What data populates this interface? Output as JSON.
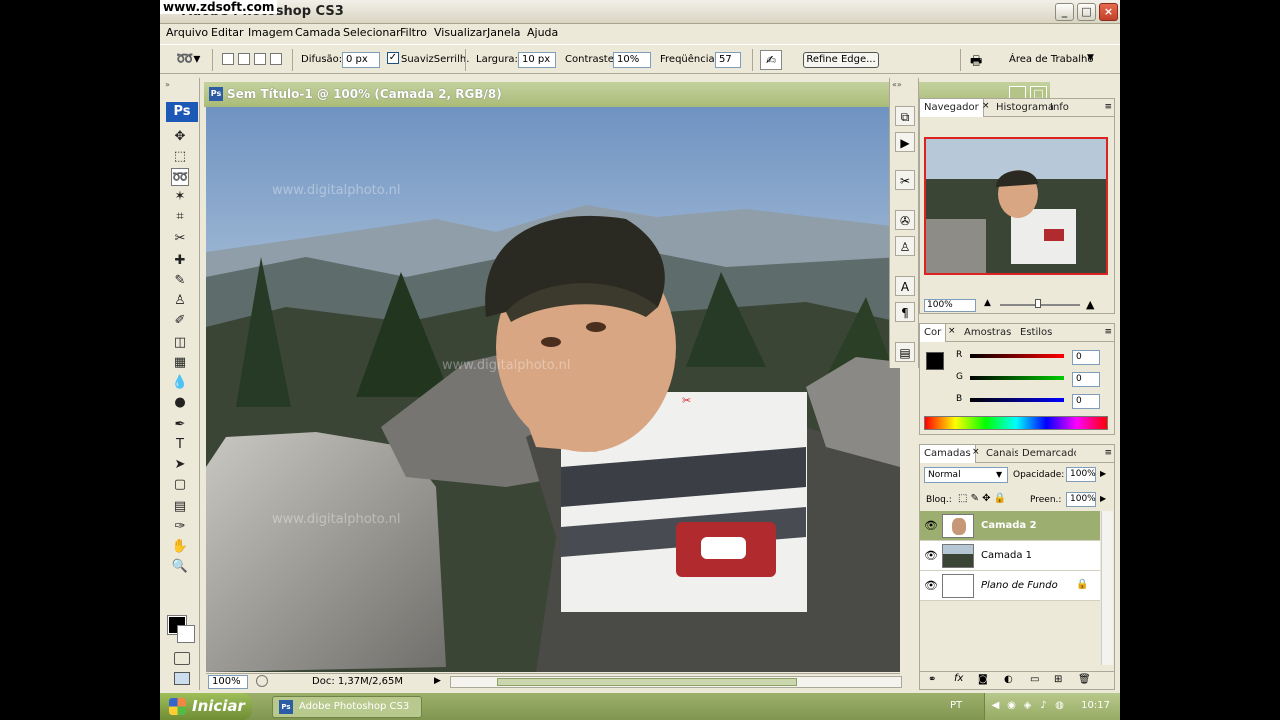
{
  "watermark": "www.zdsoft.com",
  "app": {
    "title": "Adobe Photoshop CS3",
    "window_buttons": {
      "minimize": "_",
      "maximize": "□",
      "close": "×"
    }
  },
  "menu": [
    "Arquivo",
    "Editar",
    "Imagem",
    "Camada",
    "Selecionar",
    "Filtro",
    "Visualizar",
    "Janela",
    "Ajuda"
  ],
  "options": {
    "feather_label": "Difusão:",
    "feather_value": "0 px",
    "antialias_label": "SuavizSerrilh.",
    "width_label": "Largura:",
    "width_value": "10 px",
    "contrast_label": "Contraste:",
    "contrast_value": "10%",
    "frequency_label": "Freqüência:",
    "frequency_value": "57",
    "refine_edge": "Refine Edge...",
    "workspace": "Área de Trabalho"
  },
  "tools": {
    "logo": "Ps",
    "icons": [
      "move-icon",
      "marquee-icon",
      "magnetic-lasso-icon",
      "magic-wand-icon",
      "crop-icon",
      "slice-icon",
      "healing-brush-icon",
      "brush-icon",
      "clone-stamp-icon",
      "history-brush-icon",
      "eraser-icon",
      "gradient-icon",
      "blur-icon",
      "dodge-icon",
      "pen-icon",
      "type-icon",
      "path-selection-icon",
      "shape-icon",
      "notes-icon",
      "eyedropper-icon",
      "hand-icon",
      "zoom-icon"
    ],
    "glyphs": [
      "✥",
      "⬚",
      "➿",
      "✶",
      "⌗",
      "✂",
      "✚",
      "✎",
      "♙",
      "✐",
      "◫",
      "▦",
      "💧",
      "●",
      "✒",
      "T",
      "➤",
      "▢",
      "▤",
      "✑",
      "✋",
      "🔍"
    ],
    "fg_color": "#000000",
    "bg_color": "#ffffff"
  },
  "document": {
    "title": "Sem Título-1 @ 100% (Camada 2, RGB/8)",
    "doc_icon": "Ps",
    "canvas_watermark": "www.digitalphoto.nl",
    "zoom": "100%",
    "info": "Doc: 1,37M/2,65M"
  },
  "navigator": {
    "tabs": [
      "Navegador",
      "Histograma",
      "Info"
    ],
    "zoom": "100%"
  },
  "color": {
    "tabs": [
      "Cor",
      "Amostras",
      "Estilos"
    ],
    "channels": [
      {
        "letter": "R",
        "value": "0",
        "gradient": "linear-gradient(90deg,#000,#f00)"
      },
      {
        "letter": "G",
        "value": "0",
        "gradient": "linear-gradient(90deg,#000,#0c0)"
      },
      {
        "letter": "B",
        "value": "0",
        "gradient": "linear-gradient(90deg,#000,#00f)"
      }
    ]
  },
  "layers": {
    "tabs": [
      "Camadas",
      "Canais",
      "Demarcadores"
    ],
    "blend_mode": "Normal",
    "opacity_label": "Opacidade:",
    "opacity_value": "100%",
    "lock_label": "Bloq.:",
    "fill_label": "Preen.:",
    "fill_value": "100%",
    "items": [
      {
        "name": "Camada 2",
        "selected": true
      },
      {
        "name": "Camada 1",
        "selected": false
      },
      {
        "name": "Plano de Fundo",
        "selected": false,
        "locked": true
      }
    ],
    "bottom_icons": [
      "⚭",
      "fx",
      "◙",
      "◐",
      "▭",
      "⊞",
      "🗑"
    ]
  },
  "taskbar": {
    "start": "Iniciar",
    "task_ps": "Adobe Photoshop CS3",
    "lang": "PT",
    "clock": "10:17"
  }
}
